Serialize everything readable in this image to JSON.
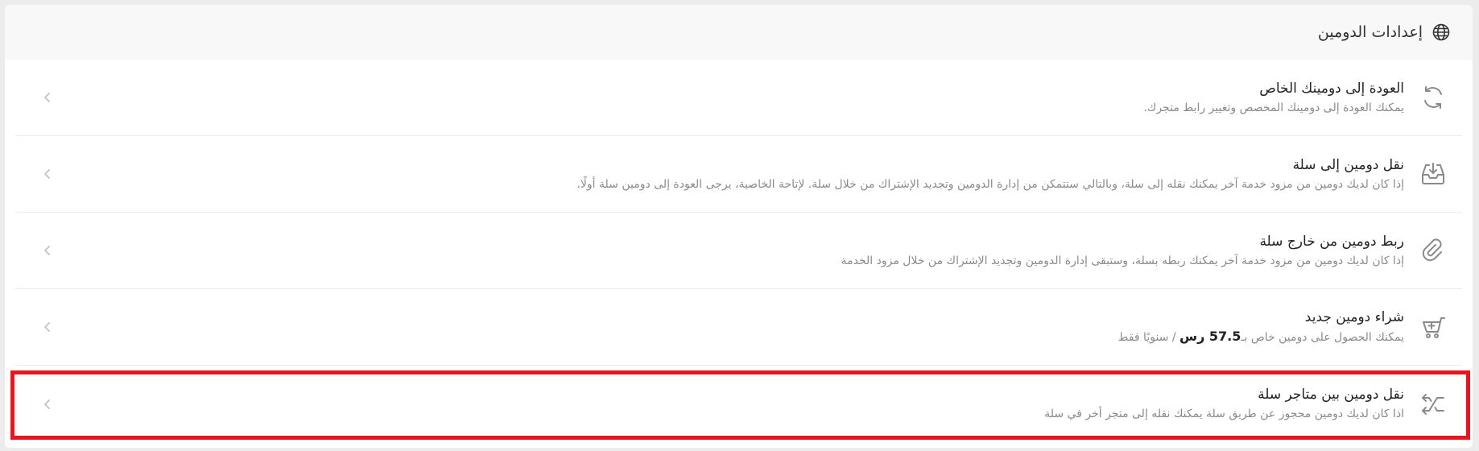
{
  "header": {
    "title": "إعدادات الدومين",
    "icon": "globe-icon"
  },
  "options": [
    {
      "name": "return-to-own-domain",
      "icon": "refresh-icon",
      "title": "العودة إلى دومينك الخاص",
      "description": "يمكنك العودة إلى دومينك المخصص وتغيير رابط متجرك."
    },
    {
      "name": "transfer-domain-to-salla",
      "icon": "inbox-download-icon",
      "title": "نقل دومين إلى سلة",
      "description": "إذا كان لديك دومين من مزود خدمة آخر يمكنك نقله إلى سلة، وبالتالي ستتمكن من إدارة الدومين وتجديد الإشتراك من خلال سلة. لإتاحة الخاصية، يرجى العودة إلى دومين سلة أولًا."
    },
    {
      "name": "link-external-domain",
      "icon": "link-icon",
      "title": "ربط دومين من خارج سلة",
      "description": "إذا كان لديك دومين من مزود خدمة آخر يمكنك ربطه بسلة، وستبقى إدارة الدومين وتجديد الإشتراك من خلال مزود الخدمة"
    },
    {
      "name": "buy-new-domain",
      "icon": "cart-add-icon",
      "title": "شراء دومين جديد",
      "description_before": "يمكنك الحصول على دومين خاص بـ",
      "price": "57.5 رس",
      "description_after": " / سنويًا فقط"
    },
    {
      "name": "transfer-between-stores",
      "icon": "shuffle-icon",
      "title": "نقل دومين بين متاجر سلة",
      "description": "اذا كان لديك دومين محجوز عن طريق سلة يمكنك نقله إلى متجر أخر في سلة"
    }
  ],
  "colors": {
    "highlight": "#e5161f",
    "icon": "#8a8a8a"
  }
}
